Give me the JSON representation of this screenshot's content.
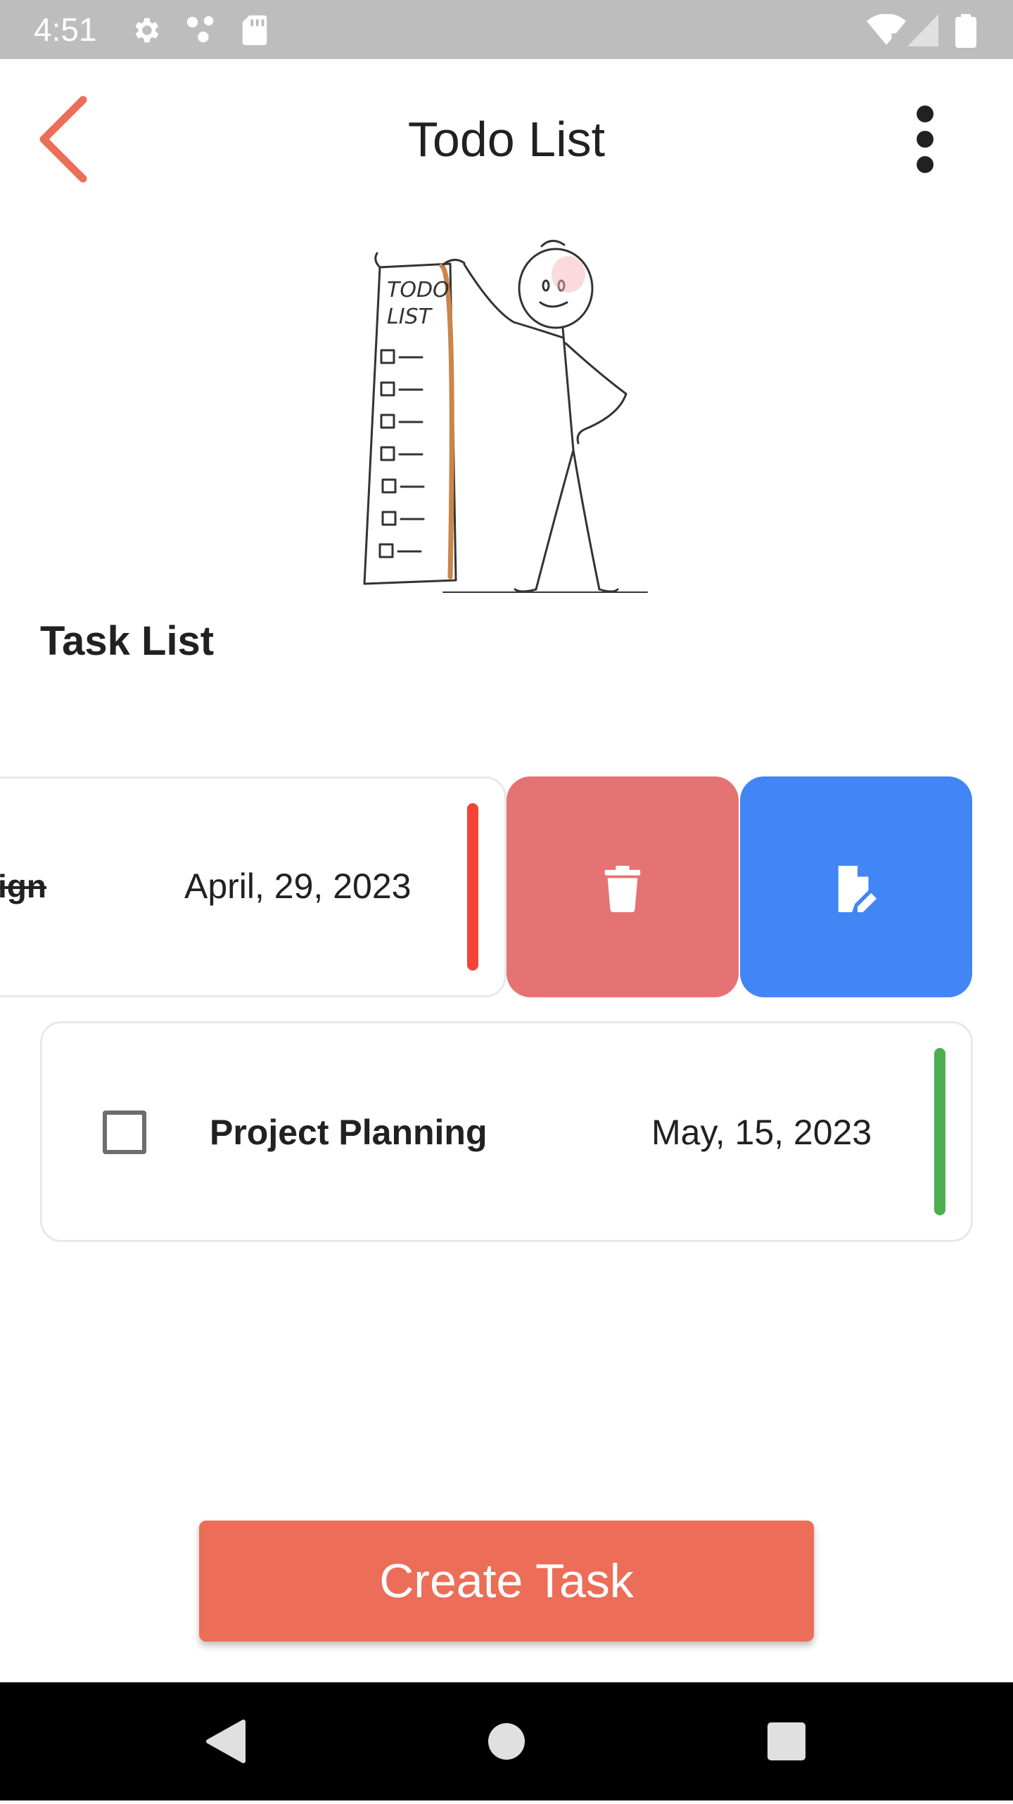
{
  "status_bar": {
    "time": "4:51",
    "icons": [
      "settings-icon",
      "network-icon",
      "sd-card-icon",
      "wifi-icon",
      "signal-icon",
      "battery-icon"
    ]
  },
  "app_bar": {
    "title": "Todo List",
    "back_icon": "chevron-left-icon",
    "menu_icon": "more-vertical-icon",
    "accent_color": "#EC6D58"
  },
  "illustration": {
    "scroll_text_line1": "TODO",
    "scroll_text_line2": "LIST"
  },
  "section": {
    "heading": "Task List"
  },
  "tasks": [
    {
      "title": "Design",
      "title_visible": "ign",
      "date": "April, 29, 2023",
      "completed": true,
      "priority_color": "#F44336",
      "swiped_open": true
    },
    {
      "title": "Project Planning",
      "date": "May, 15, 2023",
      "completed": false,
      "priority_color": "#4CAF50",
      "swiped_open": false
    }
  ],
  "swipe_actions": {
    "delete": {
      "icon": "trash-icon",
      "color": "#E57373"
    },
    "edit": {
      "icon": "edit-document-icon",
      "color": "#4285F4"
    }
  },
  "create_button": {
    "label": "Create Task"
  },
  "nav_bar": {
    "icons": [
      "back-triangle-icon",
      "home-circle-icon",
      "recents-square-icon"
    ]
  }
}
